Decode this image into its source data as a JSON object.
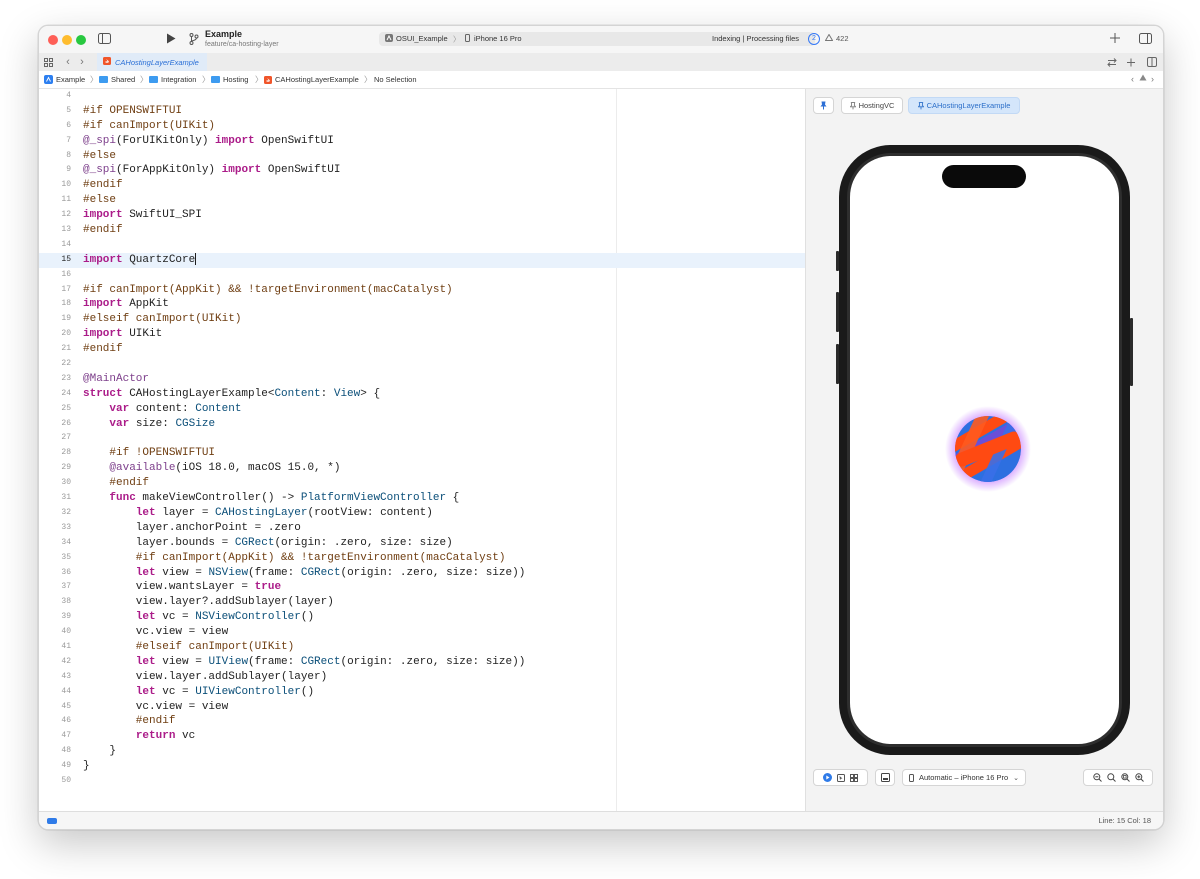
{
  "window": {
    "project_name": "Example",
    "branch": "feature/ca-hosting-layer",
    "scheme": "OSUI_Example",
    "destination": "iPhone 16 Pro",
    "activity": "Indexing | Processing files",
    "activity_count": "2",
    "warnings": "422"
  },
  "tab": {
    "label": "CAHostingLayerExample"
  },
  "jumpbar": {
    "items": [
      "Example",
      "Shared",
      "Integration",
      "Hosting",
      "CAHostingLayerExample",
      "No Selection"
    ]
  },
  "editor": {
    "current_line": 15,
    "lines": [
      {
        "n": "4",
        "t": ""
      },
      {
        "n": "5",
        "t": "#if OPENSWIFTUI"
      },
      {
        "n": "6",
        "t": "#if canImport(UIKit)"
      },
      {
        "n": "7",
        "t": "@_spi(ForUIKitOnly) import OpenSwiftUI"
      },
      {
        "n": "8",
        "t": "#else"
      },
      {
        "n": "9",
        "t": "@_spi(ForAppKitOnly) import OpenSwiftUI"
      },
      {
        "n": "10",
        "t": "#endif"
      },
      {
        "n": "11",
        "t": "#else"
      },
      {
        "n": "12",
        "t": "import SwiftUI_SPI"
      },
      {
        "n": "13",
        "t": "#endif"
      },
      {
        "n": "14",
        "t": ""
      },
      {
        "n": "15",
        "t": "import QuartzCore"
      },
      {
        "n": "16",
        "t": ""
      },
      {
        "n": "17",
        "t": "#if canImport(AppKit) && !targetEnvironment(macCatalyst)"
      },
      {
        "n": "18",
        "t": "import AppKit"
      },
      {
        "n": "19",
        "t": "#elseif canImport(UIKit)"
      },
      {
        "n": "20",
        "t": "import UIKit"
      },
      {
        "n": "21",
        "t": "#endif"
      },
      {
        "n": "22",
        "t": ""
      },
      {
        "n": "23",
        "t": "@MainActor"
      },
      {
        "n": "24",
        "t": "struct CAHostingLayerExample<Content: View> {"
      },
      {
        "n": "25",
        "t": "    var content: Content"
      },
      {
        "n": "26",
        "t": "    var size: CGSize"
      },
      {
        "n": "27",
        "t": ""
      },
      {
        "n": "28",
        "t": "    #if !OPENSWIFTUI"
      },
      {
        "n": "29",
        "t": "    @available(iOS 18.0, macOS 15.0, *)"
      },
      {
        "n": "30",
        "t": "    #endif"
      },
      {
        "n": "31",
        "t": "    func makeViewController() -> PlatformViewController {"
      },
      {
        "n": "32",
        "t": "        let layer = CAHostingLayer(rootView: content)"
      },
      {
        "n": "33",
        "t": "        layer.anchorPoint = .zero"
      },
      {
        "n": "34",
        "t": "        layer.bounds = CGRect(origin: .zero, size: size)"
      },
      {
        "n": "35",
        "t": "        #if canImport(AppKit) && !targetEnvironment(macCatalyst)"
      },
      {
        "n": "36",
        "t": "        let view = NSView(frame: CGRect(origin: .zero, size: size))"
      },
      {
        "n": "37",
        "t": "        view.wantsLayer = true"
      },
      {
        "n": "38",
        "t": "        view.layer?.addSublayer(layer)"
      },
      {
        "n": "39",
        "t": "        let vc = NSViewController()"
      },
      {
        "n": "40",
        "t": "        vc.view = view"
      },
      {
        "n": "41",
        "t": "        #elseif canImport(UIKit)"
      },
      {
        "n": "42",
        "t": "        let view = UIView(frame: CGRect(origin: .zero, size: size))"
      },
      {
        "n": "43",
        "t": "        view.layer.addSublayer(layer)"
      },
      {
        "n": "44",
        "t": "        let vc = UIViewController()"
      },
      {
        "n": "45",
        "t": "        vc.view = view"
      },
      {
        "n": "46",
        "t": "        #endif"
      },
      {
        "n": "47",
        "t": "        return vc"
      },
      {
        "n": "48",
        "t": "    }"
      },
      {
        "n": "49",
        "t": "}"
      },
      {
        "n": "50",
        "t": ""
      }
    ]
  },
  "canvas": {
    "pins": [
      "HostingVC",
      "CAHostingLayerExample"
    ],
    "device_menu": "Automatic – iPhone 16 Pro"
  },
  "status": {
    "position": "Line: 15  Col: 18"
  },
  "colors": {
    "accent": "#2f7be8",
    "swirl_orange": "#ff4a12",
    "swirl_blue": "#2d6fe0",
    "glow": "#b455ff"
  }
}
